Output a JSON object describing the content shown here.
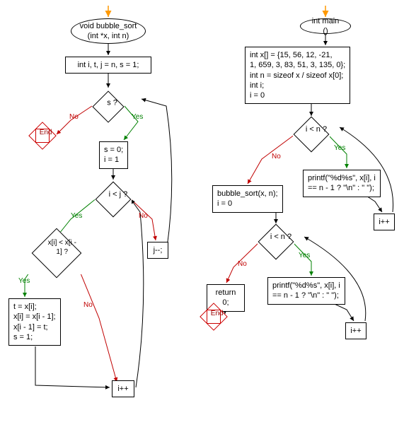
{
  "left": {
    "start": "void bubble_sort\n(int *x, int n)",
    "init": "int i, t, j = n, s = 1;",
    "cond_s": "s ?",
    "end": "End",
    "reset": "s = 0;\ni = 1",
    "cond_ij": "i < j ?",
    "cond_cmp": "x[i] < x[i - 1] ?",
    "swap": "t = x[i];\nx[i] = x[i - 1];\nx[i - 1] = t;\ns = 1;",
    "jdec": "j--;",
    "iinc": "i++"
  },
  "right": {
    "start": "int main ()",
    "init": "int x[] = {15, 56, 12, -21,\n1, 659, 3, 83, 51, 3, 135, 0};\nint n = sizeof x / sizeof x[0];\nint i;\ni = 0",
    "cond1": "i < n ?",
    "print1": "printf(\"%d%s\", x[i], i\n== n - 1 ? \"\\n\" : \" \");",
    "iinc1": "i++",
    "call": "bubble_sort(x, n);\ni = 0",
    "cond2": "i < n ?",
    "print2": "printf(\"%d%s\", x[i], i\n== n - 1 ? \"\\n\" : \" \");",
    "iinc2": "i++",
    "return": "return 0;",
    "end": "End"
  },
  "labels": {
    "yes": "Yes",
    "no": "No"
  }
}
